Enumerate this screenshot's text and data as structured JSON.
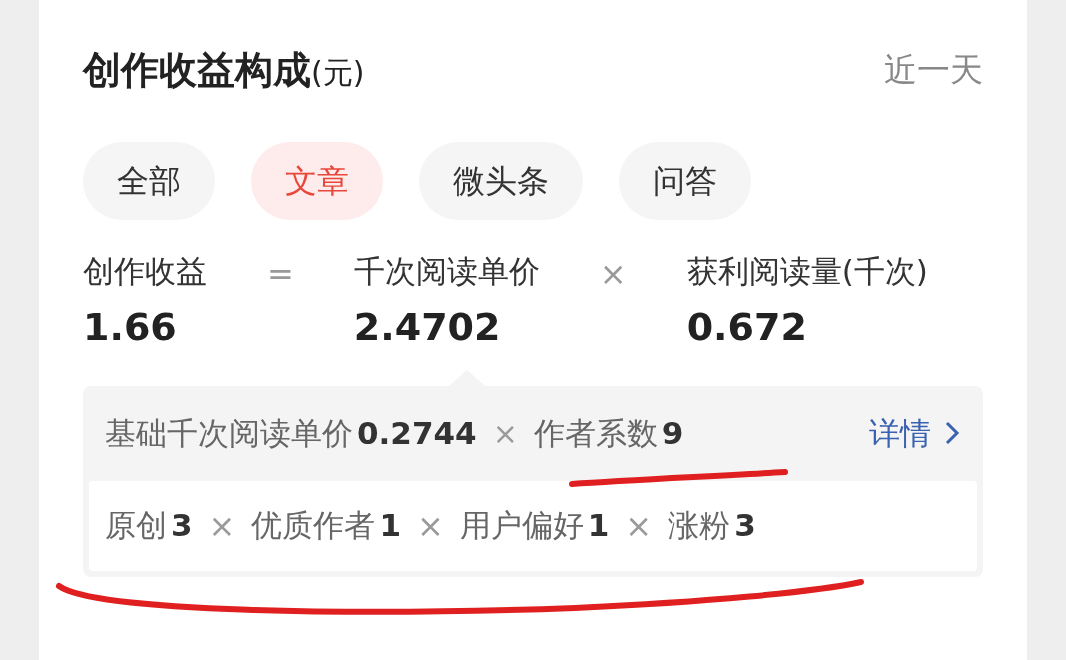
{
  "header": {
    "title": "创作收益构成",
    "unit": "(元)",
    "period": "近一天"
  },
  "tabs": [
    {
      "label": "全部",
      "selected": false
    },
    {
      "label": "文章",
      "selected": true
    },
    {
      "label": "微头条",
      "selected": false
    },
    {
      "label": "问答",
      "selected": false
    }
  ],
  "formula": [
    {
      "kind": "term",
      "label": "创作收益",
      "value": "1.66"
    },
    {
      "kind": "operator",
      "text": "="
    },
    {
      "kind": "term",
      "label": "千次阅读单价",
      "value": "2.4702"
    },
    {
      "kind": "operator",
      "text": "×"
    },
    {
      "kind": "term",
      "label": "获利阅读量(千次)",
      "value": "0.672"
    }
  ],
  "detail": [
    {
      "kind": "factor",
      "label": "基础千次阅读单价",
      "value": "0.2744"
    },
    {
      "kind": "operator",
      "text": "×"
    },
    {
      "kind": "factor",
      "label": "作者系数",
      "value": "9"
    }
  ],
  "detail_link": "详情",
  "factors": [
    {
      "kind": "factor",
      "label": "原创",
      "value": "3"
    },
    {
      "kind": "operator",
      "text": "×"
    },
    {
      "kind": "factor",
      "label": "优质作者",
      "value": "1"
    },
    {
      "kind": "operator",
      "text": "×"
    },
    {
      "kind": "factor",
      "label": "用户偏好",
      "value": "1"
    },
    {
      "kind": "operator",
      "text": "×"
    },
    {
      "kind": "factor",
      "label": "涨粉",
      "value": "3"
    }
  ]
}
